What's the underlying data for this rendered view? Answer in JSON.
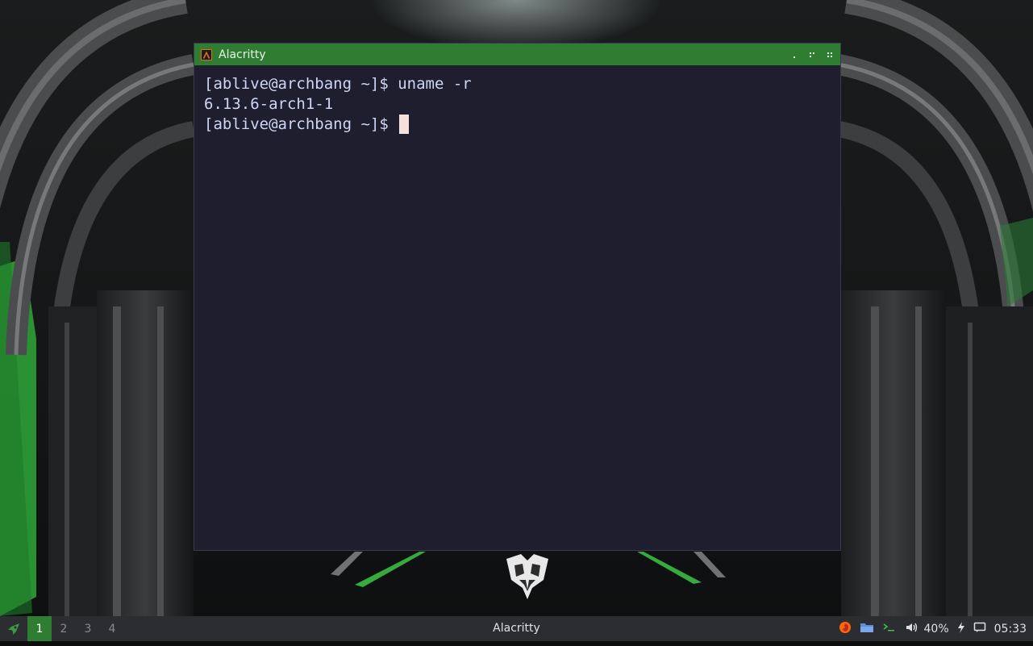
{
  "window": {
    "title": "Alacritty",
    "terminal_lines": [
      "[ablive@archbang ~]$ uname -r",
      "6.13.6-arch1-1",
      "[ablive@archbang ~]$ "
    ]
  },
  "panel": {
    "workspaces": [
      "1",
      "2",
      "3",
      "4"
    ],
    "active_workspace": "1",
    "taskbar_title": "Alacritty",
    "volume": "40%",
    "clock": "05:33",
    "tray_icons": [
      "firefox-icon",
      "folder-icon",
      "terminal-icon",
      "volume-icon",
      "battery-charging-icon",
      "notification-icon"
    ]
  },
  "colors": {
    "titlebar": "#2e7d32",
    "terminal_bg": "#1e1e2e",
    "terminal_fg": "#cdd6f4",
    "cursor": "#f5e0dc",
    "panel_bg": "#2c2d30",
    "active_workspace": "#2e7d32"
  }
}
